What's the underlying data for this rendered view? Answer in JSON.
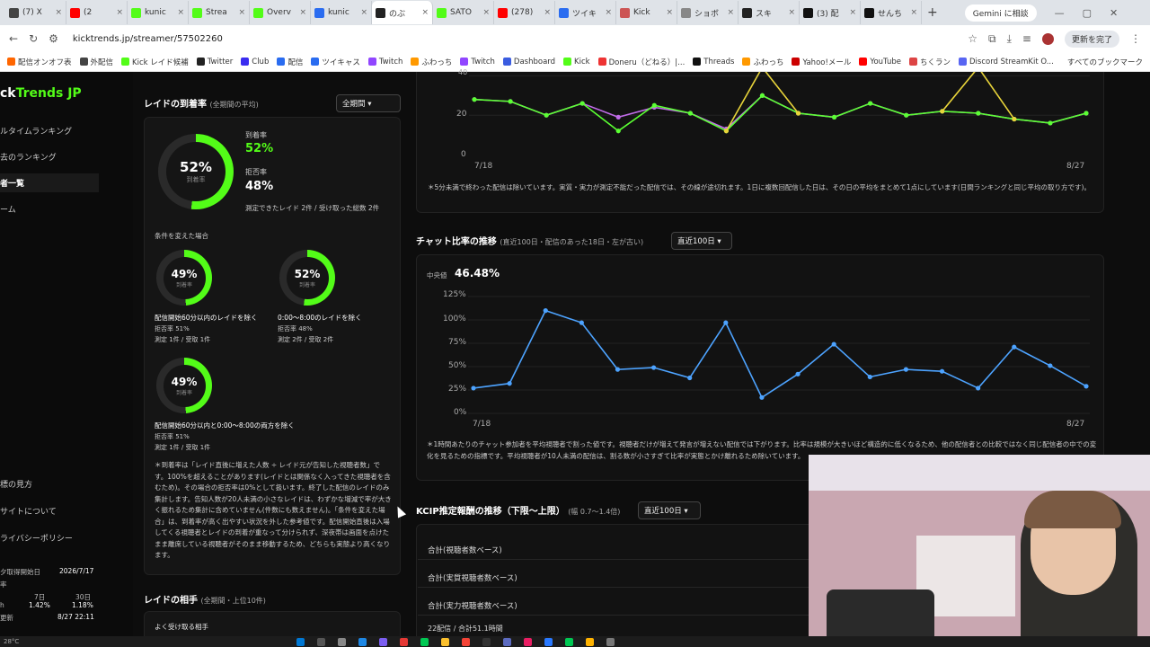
{
  "browser": {
    "tabs": [
      "(7) X",
      "(2",
      "kunic",
      "Strea",
      "Overv",
      "kunic",
      "のぶ",
      "SATO",
      "(278)",
      "ツイキ",
      "Kick",
      "ショボ",
      "スキ",
      "(3) 配",
      "せんち"
    ],
    "gemini_label": "Gemini に相談",
    "url": "kicktrends.jp/streamer/57502260",
    "update_label": "更新を完了",
    "bookmarks": [
      "配信オンオフ表",
      "外配信",
      "Kick レイド候補",
      "Twitter",
      "Club",
      "配信",
      "ツイキャス",
      "Twitch",
      "ふわっち",
      "Twitch",
      "Dashboard",
      "Kick",
      "Doneru（どねる）|...",
      "Threads",
      "ふわっち",
      "Yahoo!メール",
      "YouTube",
      "ちくラン",
      "Discord StreamKit O..."
    ],
    "all_bookmarks": "すべてのブックマーク"
  },
  "sidebar": {
    "logo_a": "ck",
    "logo_b": "Trends JP",
    "nav": [
      "ルタイムランキング",
      "去のランキング",
      "者一覧",
      "ーム"
    ],
    "links": [
      "標の見方",
      "サイトについて",
      "ライバシーポリシー"
    ],
    "date_label": "夕取得開始日",
    "date_value": "2026/7/17",
    "rate_label": "率",
    "col_7": "7日",
    "col_30": "30日",
    "row_a": "h",
    "val_7": "1.42%",
    "val_30": "1.18%",
    "update_label": "更新",
    "update_value": "8/27 22:11",
    "temp": "28°C"
  },
  "raid": {
    "title": "レイドの到着率",
    "subtitle": "(全期間の平均)",
    "select": "全期間",
    "main_pct": "52%",
    "main_ring": "到着率",
    "arrival_label": "到着率",
    "arrival_value": "52%",
    "reject_label": "拒否率",
    "reject_value": "48%",
    "measured": "測定できたレイド 2件 / 受け取った総数 2件",
    "conditions_title": "条件を変えた場合",
    "c1": {
      "pct": "49%",
      "ring": "到着率",
      "title": "配信開始60分以内のレイドを除く",
      "l1": "拒否率 51%",
      "l2": "測定 1件 / 受取 1件"
    },
    "c2": {
      "pct": "52%",
      "ring": "到着率",
      "title": "0:00〜8:00のレイドを除く",
      "l1": "拒否率 48%",
      "l2": "測定 2件 / 受取 2件"
    },
    "c3": {
      "pct": "49%",
      "ring": "到着率",
      "title": "配信開始60分以内と0:00〜8:00の両方を除く",
      "l1": "拒否率 51%",
      "l2": "測定 1件 / 受取 1件"
    },
    "note": "＊到着率は「レイド直後に増えた人数 ÷ レイド元が告知した視聴者数」です。100%を超えることがあります(レイドとは関係なく入ってきた視聴者を含むため)。その場合の拒否率は0%として扱います。終了した配信のレイドのみ集計します。告知人数が20人未満の小さなレイドは、わずかな増減で率が大きく振れるため集計に含めていません(件数にも数えません)。「条件を変えた場合」は、到着率が高く出やすい状況を外した参考値です。配信開始直後は入場してくる視聴者とレイドの到着が重なって分けられず、深夜帯は画面を点けたまま離席している視聴者がそのまま移動するため、どちらも実態より高くなります。",
    "partner_title": "レイドの相手",
    "partner_sub": "(全期間・上位10件)",
    "partner_received": "よく受け取る相手"
  },
  "top_chart": {
    "y_ticks": [
      "40",
      "20",
      "0"
    ],
    "x_start": "7/18",
    "x_end": "8/27",
    "note": "＊5分未満で終わった配信は除いています。実質・実力が測定不能だった配信では、その線が途切れます。1日に複数回配信した日は、その日の平均をまとめて1点にしています(日間ランキングと同じ平均の取り方です)。",
    "colors": {
      "purple": "#c06be8",
      "green": "#5bff33",
      "yellow": "#e8d43a"
    }
  },
  "chat_ratio": {
    "title": "チャット比率の推移",
    "subtitle": "(直近100日・配信のあった18日・左が古い)",
    "select": "直近100日",
    "median_label": "中央値",
    "median_value": "46.48%",
    "y_ticks": [
      "125%",
      "100%",
      "75%",
      "50%",
      "25%",
      "0%"
    ],
    "x_start": "7/18",
    "x_end": "8/27",
    "note": "＊1時間あたりのチャット参加者を平均視聴者で割った値です。視聴者だけが増えて発言が増えない配信では下がります。比率は規模が大きいほど構造的に低くなるため、他の配信者との比較ではなく同じ配信者の中での変化を見るための指標です。平均視聴者が10人未満の配信は、割る数が小さすぎて比率が実態とかけ離れるため除いています。"
  },
  "chart_data": [
    {
      "type": "line",
      "x": [
        "7/18",
        "",
        "",
        "",
        "",
        "",
        "",
        "",
        "",
        "",
        "",
        "",
        "",
        "",
        "",
        "",
        "",
        "8/27"
      ],
      "series": [
        {
          "values": [
            28,
            27,
            20,
            26,
            19,
            24,
            21,
            13,
            30,
            21,
            19,
            26,
            20,
            22,
            21,
            18,
            16,
            21
          ],
          "color": "#c06be8"
        },
        {
          "values": [
            28,
            27,
            20,
            26,
            12,
            25,
            21,
            12,
            30,
            21,
            19,
            26,
            20,
            22,
            21,
            18,
            16,
            21
          ],
          "color": "#5bff33"
        },
        {
          "values": [
            null,
            null,
            null,
            null,
            null,
            null,
            null,
            12,
            60,
            21,
            null,
            null,
            null,
            22,
            60,
            18,
            null,
            null
          ],
          "color": "#e8d43a"
        }
      ],
      "ylim": [
        0,
        42
      ]
    },
    {
      "type": "line",
      "x": [
        "7/18",
        "",
        "",
        "",
        "",
        "",
        "",
        "",
        "",
        "",
        "",
        "",
        "",
        "",
        "",
        "",
        "",
        "8/27"
      ],
      "series": [
        {
          "values": [
            27,
            32,
            110,
            97,
            47,
            49,
            38,
            97,
            17,
            42,
            74,
            39,
            47,
            45,
            27,
            71,
            51,
            29
          ],
          "color": "#4da3ff"
        }
      ],
      "ylim": [
        0,
        125
      ]
    }
  ],
  "kcip": {
    "title": "KCIP推定報酬の推移（下限〜上限）",
    "subtitle": "(幅 0.7〜1.4倍)",
    "select": "直近100日",
    "rows": [
      "合計(視聴者数ベース)",
      "合計(実質視聴者数ベース)",
      "合計(実力視聴者数ベース)"
    ],
    "summary": "22配信 / 合計51.1時間"
  }
}
